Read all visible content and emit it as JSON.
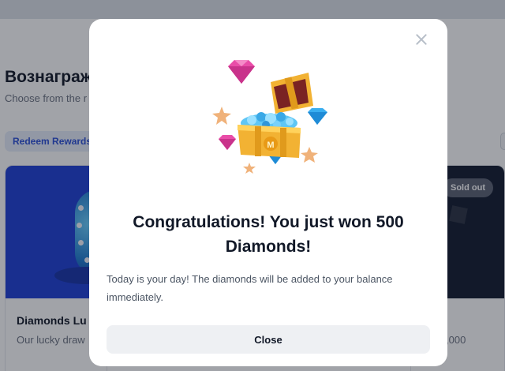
{
  "background": {
    "page_title": "Вознаграж",
    "page_subtitle": "Choose from the r",
    "tab_redeem_label": "Redeem Rewards",
    "card_left": {
      "title": "Diamonds Lu",
      "description": "Our lucky draw"
    },
    "card_right": {
      "badge": "Sold out",
      "price": ",000"
    }
  },
  "modal": {
    "title": "Congratulations! You just won 500 Diamonds!",
    "description": "Today is your day! The diamonds will be added to your balance immediately.",
    "close_button_label": "Close",
    "illustration_icon": "treasure-chest-with-diamonds",
    "colors": {
      "chest": "#f2b233",
      "diamond_pink": "#e94da8",
      "diamond_blue": "#39aef0",
      "star": "#f0b27a"
    }
  }
}
